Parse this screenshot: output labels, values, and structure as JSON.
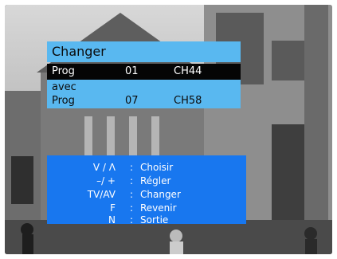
{
  "change_panel": {
    "title": "Changer",
    "selected_row": {
      "label": "Prog",
      "number": "01",
      "channel": "CH44"
    },
    "with_label": "avec",
    "target_row": {
      "label": "Prog",
      "number": "07",
      "channel": "CH58"
    }
  },
  "help_panel": {
    "items": [
      {
        "key": "V / Λ",
        "separator": ":",
        "action": "Choisir"
      },
      {
        "key": "–/ +",
        "separator": ":",
        "action": "Régler"
      },
      {
        "key": "TV/AV",
        "separator": ":",
        "action": "Changer"
      },
      {
        "key": "F",
        "separator": ":",
        "action": "Revenir"
      },
      {
        "key": "N",
        "separator": ":",
        "action": "Sortie"
      }
    ]
  },
  "colors": {
    "title_bar": "#59b8f0",
    "selected_row": "#050505",
    "help_panel": "#1877ef",
    "text_light": "#ffffff",
    "text_dark": "#0b0b0b"
  }
}
